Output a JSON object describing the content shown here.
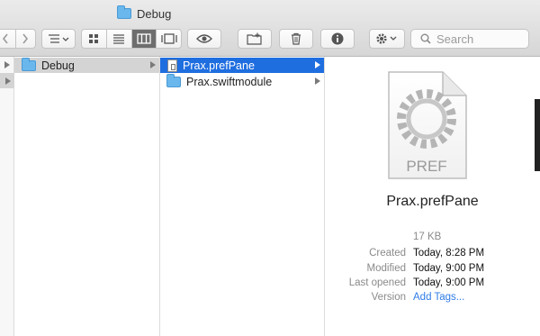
{
  "window": {
    "title": "Debug"
  },
  "toolbar": {
    "back_icon": "chevron-left-icon",
    "forward_icon": "chevron-right-icon",
    "group_icon": "group-by-icon",
    "views": [
      "icon-view-icon",
      "list-view-icon",
      "column-view-icon",
      "gallery-view-icon"
    ],
    "active_view": "column-view-icon",
    "quicklook_icon": "eye-icon",
    "new_folder_icon": "new-folder-icon",
    "trash_icon": "trash-icon",
    "info_icon": "info-icon",
    "action_icon": "gear-icon",
    "search_placeholder": "Search"
  },
  "columns": {
    "col1": [
      {
        "label": "Debug",
        "type": "folder",
        "selected": true,
        "has_children": true
      }
    ],
    "col2": [
      {
        "label": "Prax.prefPane",
        "type": "file",
        "selected": true,
        "has_children": true
      },
      {
        "label": "Prax.swiftmodule",
        "type": "folder",
        "selected": false,
        "has_children": true
      }
    ]
  },
  "preview": {
    "icon_label": "PREF",
    "name": "Prax.prefPane",
    "size": "17 KB",
    "info": [
      {
        "label": "Created",
        "value": "Today, 8:28 PM"
      },
      {
        "label": "Modified",
        "value": "Today, 9:00 PM"
      },
      {
        "label": "Last opened",
        "value": "Today, 9:00 PM"
      },
      {
        "label": "Version",
        "value": "Add Tags..."
      }
    ]
  },
  "colors": {
    "selection": "#1f6ee0",
    "folder": "#69b7ec",
    "link": "#2f7ce6"
  }
}
